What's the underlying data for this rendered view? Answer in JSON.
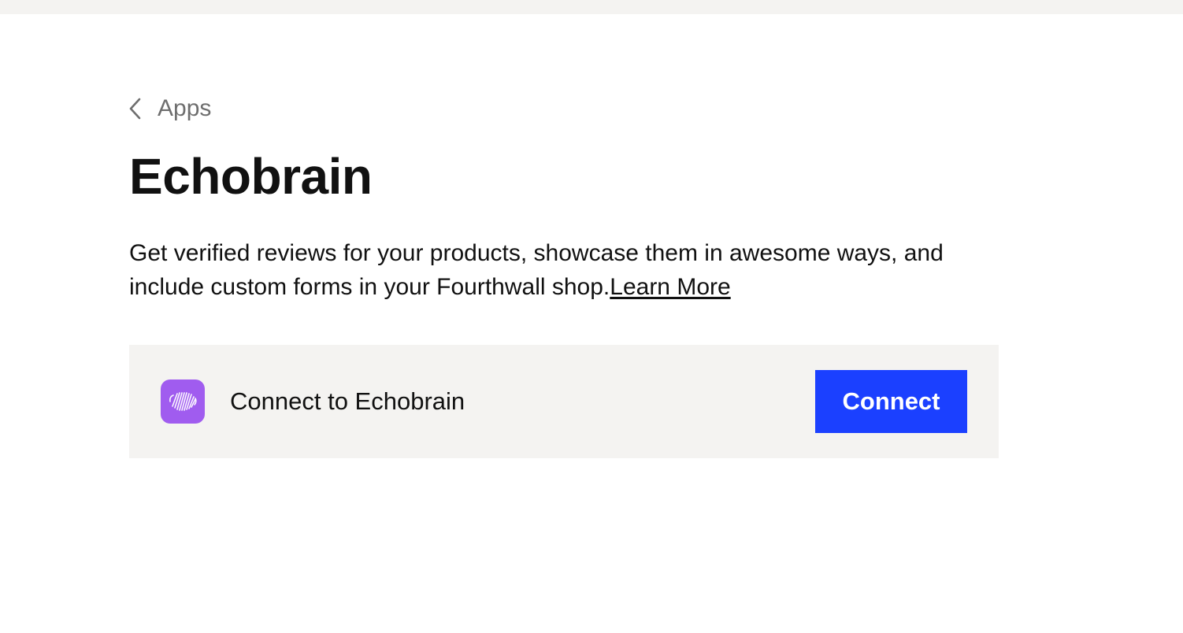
{
  "breadcrumb": {
    "back_icon": "chevron-left-icon",
    "label": "Apps"
  },
  "page": {
    "title": "Echobrain",
    "description": "Get verified reviews for your products, showcase them in awesome ways, and include custom forms in your Fourthwall shop.",
    "learn_more_label": "Learn More"
  },
  "connect_card": {
    "logo_icon": "echobrain-brain-icon",
    "logo_color": "#a05cef",
    "label": "Connect to Echobrain",
    "button_label": "Connect",
    "button_color": "#1b40ff",
    "background": "#f4f3f1"
  }
}
